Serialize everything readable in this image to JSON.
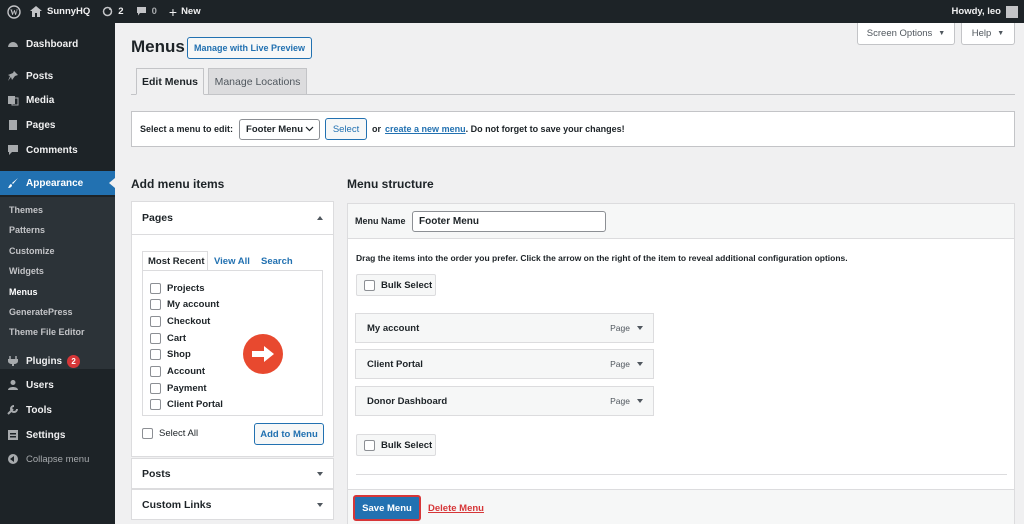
{
  "adminbar": {
    "site_name": "SunnyHQ",
    "updates_count": "2",
    "comments_count": "0",
    "new_label": "New",
    "howdy": "Howdy, leo"
  },
  "sidebar": {
    "items": [
      {
        "label": "Dashboard",
        "icon": "dashboard-icon"
      },
      {
        "label": "Posts",
        "icon": "pin-icon"
      },
      {
        "label": "Media",
        "icon": "media-icon"
      },
      {
        "label": "Pages",
        "icon": "page-icon"
      },
      {
        "label": "Comments",
        "icon": "comment-icon"
      },
      {
        "label": "Appearance",
        "icon": "brush-icon"
      },
      {
        "label": "Plugins",
        "icon": "plug-icon",
        "badge": "2"
      },
      {
        "label": "Users",
        "icon": "user-icon"
      },
      {
        "label": "Tools",
        "icon": "wrench-icon"
      },
      {
        "label": "Settings",
        "icon": "settings-icon"
      }
    ],
    "submenu": [
      "Themes",
      "Patterns",
      "Customize",
      "Widgets",
      "Menus",
      "GeneratePress",
      "Theme File Editor"
    ],
    "collapse_label": "Collapse menu"
  },
  "screen_options": "Screen Options",
  "help": "Help",
  "page_title": "Menus",
  "live_preview": "Manage with Live Preview",
  "tabs": {
    "edit": "Edit Menus",
    "locations": "Manage Locations"
  },
  "select_row": {
    "label": "Select a menu to edit:",
    "selected": "Footer Menu",
    "button": "Select",
    "or": "or",
    "create_link": "create a new menu",
    "suffix": ". Do not forget to save your changes!"
  },
  "add_items": {
    "heading": "Add menu items",
    "pages_title": "Pages",
    "inner_tabs": [
      "Most Recent",
      "View All",
      "Search"
    ],
    "pages": [
      "Projects",
      "My account",
      "Checkout",
      "Cart",
      "Shop",
      "Account",
      "Payment",
      "Client Portal"
    ],
    "select_all": "Select All",
    "add_button": "Add to Menu",
    "posts_title": "Posts",
    "custom_links_title": "Custom Links"
  },
  "structure": {
    "heading": "Menu structure",
    "name_label": "Menu Name",
    "name_value": "Footer Menu",
    "instructions": "Drag the items into the order you prefer. Click the arrow on the right of the item to reveal additional configuration options.",
    "bulk_select": "Bulk Select",
    "items": [
      {
        "title": "My account",
        "type": "Page"
      },
      {
        "title": "Client Portal",
        "type": "Page"
      },
      {
        "title": "Donor Dashboard",
        "type": "Page"
      }
    ],
    "save": "Save Menu",
    "delete": "Delete Menu"
  },
  "colors": {
    "accent": "#2271b1",
    "sidebar": "#1d2327",
    "danger": "#d63638",
    "arrow": "#e8492f"
  }
}
